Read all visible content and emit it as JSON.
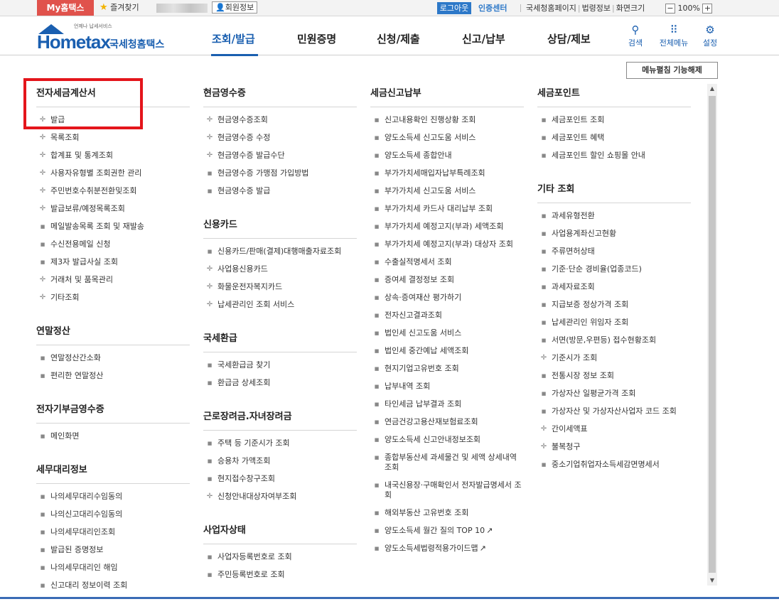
{
  "topbar": {
    "my_hometax": "My홈택스",
    "favorites": "즐겨찾기",
    "member_info": "회원정보",
    "logout": "로그아웃",
    "cert_center": "인증센터",
    "links": [
      "국세청홈페이지",
      "법령정보",
      "화면크기"
    ],
    "zoom_minus": "−",
    "zoom_value": "100%",
    "zoom_plus": "+"
  },
  "header": {
    "logo_sub": "언제나 납세서비스",
    "logo_main": "Hometax",
    "logo_kor": "국세청홈택스",
    "nav": [
      "조회/발급",
      "민원증명",
      "신청/제출",
      "신고/납부",
      "상담/제보"
    ],
    "icons": {
      "search": "검색",
      "allmenu": "전체메뉴",
      "settings": "설정"
    }
  },
  "unfold_button": "메뉴펼침 기능해제",
  "columns": [
    [
      {
        "title": "전자세금계산서",
        "items": [
          {
            "label": "발급",
            "marker": "plus"
          },
          {
            "label": "목록조회",
            "marker": "plus"
          },
          {
            "label": "합계표 및 통계조회",
            "marker": "plus"
          },
          {
            "label": "사용자유형별 조회권한 관리",
            "marker": "plus"
          },
          {
            "label": "주민번호수취분전환및조회",
            "marker": "plus"
          },
          {
            "label": "발급보류/예정목록조회",
            "marker": "plus"
          },
          {
            "label": "메일발송목록 조회 및 재발송",
            "marker": "square"
          },
          {
            "label": "수신전용메일 신청",
            "marker": "square"
          },
          {
            "label": "제3자 발급사실 조회",
            "marker": "square"
          },
          {
            "label": "거래처 및 품목관리",
            "marker": "plus"
          },
          {
            "label": "기타조회",
            "marker": "plus"
          }
        ]
      },
      {
        "title": "연말정산",
        "items": [
          {
            "label": "연말정산간소화",
            "marker": "square"
          },
          {
            "label": "편리한 연말정산",
            "marker": "square"
          }
        ]
      },
      {
        "title": "전자기부금영수증",
        "items": [
          {
            "label": "메인화면",
            "marker": "square"
          }
        ]
      },
      {
        "title": "세무대리정보",
        "items": [
          {
            "label": "나의세무대리수임동의",
            "marker": "square"
          },
          {
            "label": "나의신고대리수임동의",
            "marker": "square"
          },
          {
            "label": "나의세무대리인조회",
            "marker": "square"
          },
          {
            "label": "발급된 증명정보",
            "marker": "square"
          },
          {
            "label": "나의세무대리인 해임",
            "marker": "square"
          },
          {
            "label": "신고대리 정보이력 조회",
            "marker": "square"
          }
        ]
      }
    ],
    [
      {
        "title": "현금영수증",
        "items": [
          {
            "label": "현금영수증조회",
            "marker": "plus"
          },
          {
            "label": "현금영수증 수정",
            "marker": "plus"
          },
          {
            "label": "현금영수증 발급수단",
            "marker": "plus"
          },
          {
            "label": "현금영수증 가맹점 가입방법",
            "marker": "square"
          },
          {
            "label": "현금영수증 발급",
            "marker": "square"
          }
        ]
      },
      {
        "title": "신용카드",
        "items": [
          {
            "label": "신용카드/판매(결제)대행매출자료조회",
            "marker": "square"
          },
          {
            "label": "사업용신용카드",
            "marker": "plus"
          },
          {
            "label": "화물운전자복지카드",
            "marker": "plus"
          },
          {
            "label": "납세관리인 조회 서비스",
            "marker": "plus"
          }
        ]
      },
      {
        "title": "국세환급",
        "items": [
          {
            "label": "국세환급금 찾기",
            "marker": "square"
          },
          {
            "label": "환급금 상세조회",
            "marker": "square"
          }
        ]
      },
      {
        "title": "근로장려금.자녀장려금",
        "items": [
          {
            "label": "주택 등 기준시가 조회",
            "marker": "square"
          },
          {
            "label": "승용차 가액조회",
            "marker": "square"
          },
          {
            "label": "현지접수창구조회",
            "marker": "square"
          },
          {
            "label": "신청안내대상자여부조회",
            "marker": "plus"
          }
        ]
      },
      {
        "title": "사업자상태",
        "items": [
          {
            "label": "사업자등록번호로 조회",
            "marker": "square"
          },
          {
            "label": "주민등록번호로 조회",
            "marker": "square"
          }
        ]
      }
    ],
    [
      {
        "title": "세금신고납부",
        "items": [
          {
            "label": "신고내용확인 진행상황 조회",
            "marker": "square"
          },
          {
            "label": "양도소득세 신고도움 서비스",
            "marker": "square"
          },
          {
            "label": "양도소득세 종합안내",
            "marker": "square"
          },
          {
            "label": "부가가치세매입자납부특례조회",
            "marker": "square"
          },
          {
            "label": "부가가치세 신고도움 서비스",
            "marker": "square"
          },
          {
            "label": "부가가치세 카드사 대리납부 조회",
            "marker": "square"
          },
          {
            "label": "부가가치세 예정고지(부과) 세액조회",
            "marker": "square"
          },
          {
            "label": "부가가치세 예정고지(부과) 대상자 조회",
            "marker": "square"
          },
          {
            "label": "수출실적명세서 조회",
            "marker": "square"
          },
          {
            "label": "증여세 결정정보 조회",
            "marker": "square"
          },
          {
            "label": "상속·증여재산 평가하기",
            "marker": "square"
          },
          {
            "label": "전자신고결과조회",
            "marker": "square"
          },
          {
            "label": "법인세 신고도움 서비스",
            "marker": "square"
          },
          {
            "label": "법인세 중간예납 세액조회",
            "marker": "square"
          },
          {
            "label": "현지기업고유번호 조회",
            "marker": "square"
          },
          {
            "label": "납부내역 조회",
            "marker": "square"
          },
          {
            "label": "타인세금 납부결과 조회",
            "marker": "square"
          },
          {
            "label": "연금건강고용산재보험료조회",
            "marker": "square"
          },
          {
            "label": "양도소득세 신고안내정보조회",
            "marker": "square"
          },
          {
            "label": "종합부동산세 과세물건 및 세액 상세내역 조회",
            "marker": "square"
          },
          {
            "label": "내국신용장·구매확인서 전자발급명세서 조회",
            "marker": "square"
          },
          {
            "label": "해외부동산 고유번호 조회",
            "marker": "square"
          },
          {
            "label": "양도소득세 월간 질의 TOP 10",
            "marker": "square",
            "ext": true
          },
          {
            "label": "양도소득세법령적용가이드맵",
            "marker": "square",
            "ext": true
          }
        ]
      }
    ],
    [
      {
        "title": "세금포인트",
        "items": [
          {
            "label": "세금포인트 조회",
            "marker": "square"
          },
          {
            "label": "세금포인트 혜택",
            "marker": "square"
          },
          {
            "label": "세금포인트 할인 쇼핑몰 안내",
            "marker": "square"
          }
        ]
      },
      {
        "title": "기타 조회",
        "items": [
          {
            "label": "과세유형전환",
            "marker": "square"
          },
          {
            "label": "사업용계좌신고현황",
            "marker": "square"
          },
          {
            "label": "주류면허상태",
            "marker": "square"
          },
          {
            "label": "기준·단순 경비율(업종코드)",
            "marker": "square"
          },
          {
            "label": "과세자료조회",
            "marker": "square"
          },
          {
            "label": "지급보증 정상가격 조회",
            "marker": "square"
          },
          {
            "label": "납세관리인 위임자 조회",
            "marker": "square"
          },
          {
            "label": "서면(방문,우편등) 접수현황조회",
            "marker": "square"
          },
          {
            "label": "기준시가 조회",
            "marker": "plus"
          },
          {
            "label": "전통시장 정보 조회",
            "marker": "square"
          },
          {
            "label": "가상자산 일평균가격 조회",
            "marker": "square"
          },
          {
            "label": "가상자산 및 가상자산사업자 코드 조회",
            "marker": "square"
          },
          {
            "label": "간이세액표",
            "marker": "plus"
          },
          {
            "label": "불복청구",
            "marker": "plus"
          },
          {
            "label": "중소기업취업자소득세감면명세서",
            "marker": "square"
          }
        ]
      }
    ]
  ],
  "colors": {
    "accent": "#1a5fb0",
    "my_hometax": "#e0524c",
    "highlight": "#e4151b"
  },
  "icons": {
    "plus": "plus-cross-icon",
    "square": "square-bullet-icon",
    "ext": "external-link-icon"
  }
}
